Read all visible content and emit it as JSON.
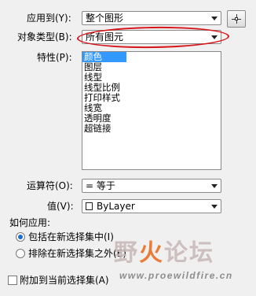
{
  "form": {
    "apply_to": {
      "label": "应用到(Y):",
      "value": "整个图形"
    },
    "object_type": {
      "label": "对象类型(B):",
      "value": "所有图元"
    },
    "properties": {
      "label": "特性(P):",
      "items": [
        "颜色",
        "图层",
        "线型",
        "线型比例",
        "打印样式",
        "线宽",
        "透明度",
        "超链接"
      ],
      "selected_index": 0
    },
    "operator": {
      "label": "运算符(O):",
      "value": "= 等于"
    },
    "value": {
      "label": "值(V):",
      "value": "ByLayer"
    },
    "how_to_apply": {
      "label": "如何应用:",
      "include": "包括在新选择集中(I)",
      "exclude": "排除在新选择集之外(E)",
      "selected": "include"
    },
    "append": {
      "label": "附加到当前选择集(A)",
      "checked": false
    }
  },
  "watermark": {
    "text_left": "野",
    "text_fire": "火",
    "text_right": "论坛",
    "url": "www.proewildfire.cn"
  },
  "colors": {
    "annotation_ellipse": "#d6161b",
    "selection": "#3399ff"
  }
}
